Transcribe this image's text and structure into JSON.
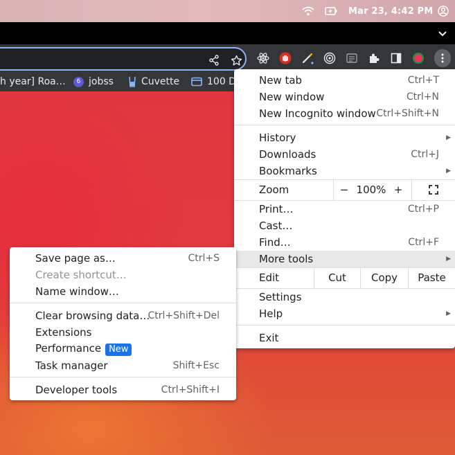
{
  "system_bar": {
    "clock": "Mar 23,  4:42 PM",
    "icons": [
      "wifi-icon",
      "battery-charging-icon",
      "user-account-icon"
    ]
  },
  "bookmarks": [
    {
      "label": "h year] Roa…",
      "icon": "page-icon"
    },
    {
      "label": "jobss",
      "icon": "badge-6",
      "badge": "6"
    },
    {
      "label": "Cuvette",
      "icon": "cuvette-icon"
    },
    {
      "label": "100 D",
      "icon": "calendar-icon"
    }
  ],
  "menu": {
    "new_tab": {
      "label": "New tab",
      "shortcut": "Ctrl+T"
    },
    "new_window": {
      "label": "New window",
      "shortcut": "Ctrl+N"
    },
    "new_incognito": {
      "label": "New Incognito window",
      "shortcut": "Ctrl+Shift+N"
    },
    "history": {
      "label": "History"
    },
    "downloads": {
      "label": "Downloads",
      "shortcut": "Ctrl+J"
    },
    "bookmarks": {
      "label": "Bookmarks"
    },
    "zoom": {
      "label": "Zoom",
      "minus": "−",
      "level": "100%",
      "plus": "+"
    },
    "print": {
      "label": "Print…",
      "shortcut": "Ctrl+P"
    },
    "cast": {
      "label": "Cast…"
    },
    "find": {
      "label": "Find…",
      "shortcut": "Ctrl+F"
    },
    "more_tools": {
      "label": "More tools"
    },
    "edit": {
      "label": "Edit",
      "cut": "Cut",
      "copy": "Copy",
      "paste": "Paste"
    },
    "settings": {
      "label": "Settings"
    },
    "help": {
      "label": "Help"
    },
    "exit": {
      "label": "Exit"
    }
  },
  "submenu": {
    "save_page": {
      "label": "Save page as…",
      "shortcut": "Ctrl+S"
    },
    "create_shortcut": {
      "label": "Create shortcut…"
    },
    "name_window": {
      "label": "Name window…"
    },
    "clear_data": {
      "label": "Clear browsing data…",
      "shortcut": "Ctrl+Shift+Del"
    },
    "extensions": {
      "label": "Extensions"
    },
    "performance": {
      "label": "Performance",
      "badge": "New"
    },
    "task_manager": {
      "label": "Task manager",
      "shortcut": "Shift+Esc"
    },
    "dev_tools": {
      "label": "Developer tools",
      "shortcut": "Ctrl+Shift+I"
    }
  },
  "colors": {
    "accent": "#1a73e8",
    "toolbar": "#35363a",
    "omnibox_focus": "#8ab4f8"
  }
}
